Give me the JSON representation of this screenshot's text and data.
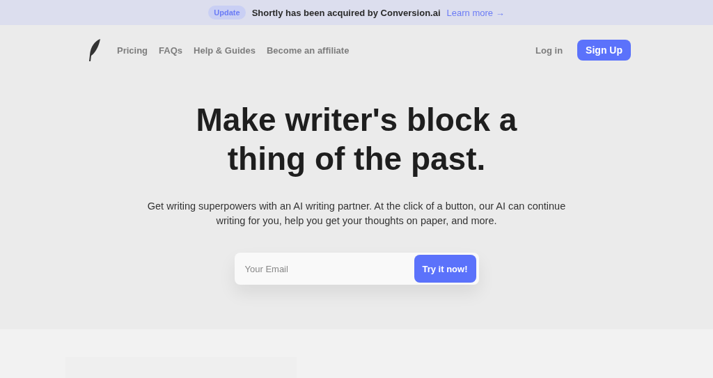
{
  "announcement": {
    "badge": "Update",
    "message": "Shortly has been acquired by Conversion.ai",
    "link": "Learn more →"
  },
  "nav": {
    "links": [
      "Pricing",
      "FAQs",
      "Help & Guides",
      "Become an affiliate"
    ],
    "login": "Log in",
    "signup": "Sign Up"
  },
  "hero": {
    "heading_lines": [
      "Make writer's block a",
      "thing of the past."
    ],
    "description": "Get writing superpowers with an AI writing partner. At the click of a button, our AI can continue writing for you, help you get your thoughts on paper, and more.",
    "email": {
      "placeholder": "Your Email"
    },
    "cta": "Try it now!"
  }
}
